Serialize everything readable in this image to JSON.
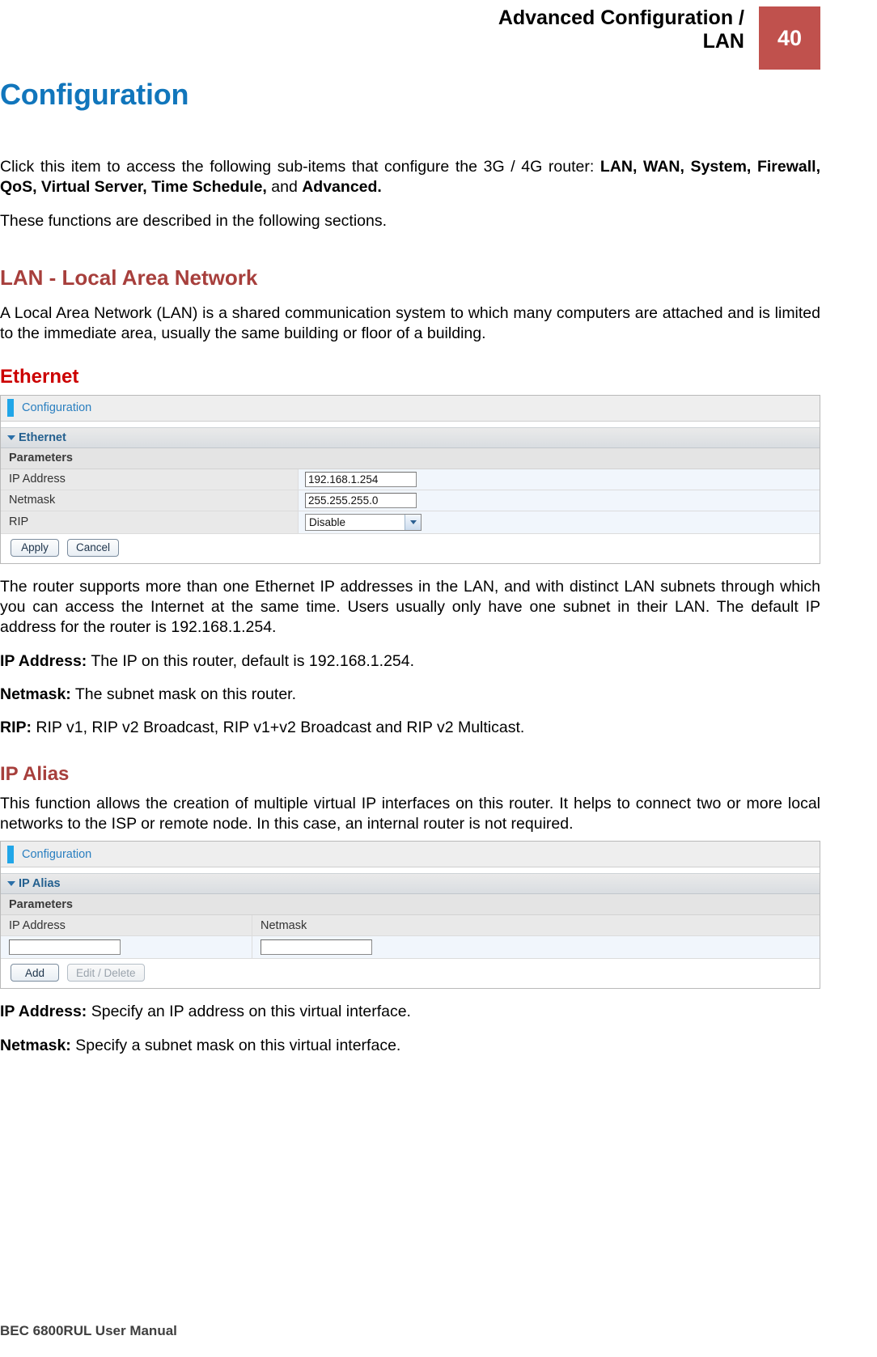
{
  "header": {
    "title": "Advanced Configuration /\nLAN",
    "page_number": "40",
    "accent_color": "#c0514d"
  },
  "doc": {
    "title": "Configuration",
    "title_color": "#1176bc",
    "intro_paragraph_1": "Click this item to access the following sub-items that configure the 3G / 4G router: LAN, WAN, System, Firewall, QoS, Virtual Server, Time Schedule, and Advanced.",
    "intro_p1_lead": "Click this item to access the following sub-items that configure the 3G / 4G router: ",
    "intro_p1_bold_1": "LAN, WAN, System, Firewall, QoS, Virtual Server, Time Schedule,",
    "intro_p1_mid": " and ",
    "intro_p1_bold_2": "Advanced.",
    "intro_paragraph_2": "These functions are described in the following sections.",
    "lan_heading": "LAN - Local Area Network",
    "lan_paragraph": "A Local Area Network (LAN) is a shared communication system to which many computers are attached and is limited to the immediate area, usually the same building or floor of a building.",
    "ethernet_heading": "Ethernet",
    "ethernet_paragraph": "The router supports more than one Ethernet IP addresses in the LAN, and with distinct LAN subnets through which you can access the Internet at the same time. Users usually only have one subnet in their LAN. The default IP address for the router is 192.168.1.254.",
    "ethernet_defs": [
      {
        "term": "IP Address:",
        "desc": " The IP on this router, default is 192.168.1.254."
      },
      {
        "term": "Netmask:",
        "desc": " The subnet mask on this router."
      },
      {
        "term": "RIP:",
        "desc": " RIP v1, RIP v2 Broadcast, RIP v1+v2 Broadcast and RIP v2 Multicast."
      }
    ],
    "ipalias_heading": "IP Alias",
    "ipalias_paragraph": "This function allows the creation of multiple virtual IP interfaces on this router. It helps to connect two or more local networks to the ISP or remote node. In this case, an internal router is not required.",
    "ipalias_defs": [
      {
        "term": "IP Address:",
        "desc": " Specify an IP address on this virtual interface."
      },
      {
        "term": "Netmask:",
        "desc": " Specify a subnet mask on this virtual interface."
      }
    ],
    "footer": "BEC 6800RUL User Manual"
  },
  "ethernet_panel": {
    "titlebar": "Configuration",
    "section": "Ethernet",
    "subhead": "Parameters",
    "rows": [
      {
        "label": "IP Address",
        "value": "192.168.1.254",
        "type": "text"
      },
      {
        "label": "Netmask",
        "value": "255.255.255.0",
        "type": "text"
      },
      {
        "label": "RIP",
        "value": "Disable",
        "type": "select"
      }
    ],
    "buttons": [
      {
        "label": "Apply",
        "state": "enabled"
      },
      {
        "label": "Cancel",
        "state": "enabled"
      }
    ]
  },
  "ipalias_panel": {
    "titlebar": "Configuration",
    "section": "IP Alias",
    "subhead": "Parameters",
    "columns": [
      "IP Address",
      "Netmask"
    ],
    "values": [
      "",
      ""
    ],
    "buttons": [
      {
        "label": "Add",
        "state": "enabled"
      },
      {
        "label": "Edit / Delete",
        "state": "disabled"
      }
    ]
  }
}
